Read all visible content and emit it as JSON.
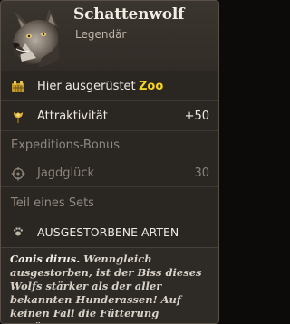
{
  "item": {
    "name": "Schattenwolf",
    "rarity": "Legendär",
    "portrait_icon": "wolf-portrait"
  },
  "equipped": {
    "label": "Hier ausgerüstet",
    "location": "Zoo",
    "icon": "enclosure-icon"
  },
  "attractiveness": {
    "label": "Attraktivität",
    "value": "+50",
    "icon": "flower-icon"
  },
  "expedition_bonus": {
    "heading": "Expeditions-Bonus",
    "stat_label": "Jagdglück",
    "stat_value": "30",
    "icon": "crosshair-icon"
  },
  "set": {
    "heading": "Teil eines Sets",
    "name": "AUSGESTORBENE ARTEN",
    "icon": "paw-icon"
  },
  "description": {
    "species": "Canis dirus.",
    "text": " Wenngleich ausgestorben, ist der Biss dieses Wolfs stärker als der aller bekannten Hunderassen! Auf keinen Fall die Fütterung versäumen!"
  },
  "colors": {
    "accent_yellow": "#f4d21e",
    "panel": "#2a2622"
  }
}
